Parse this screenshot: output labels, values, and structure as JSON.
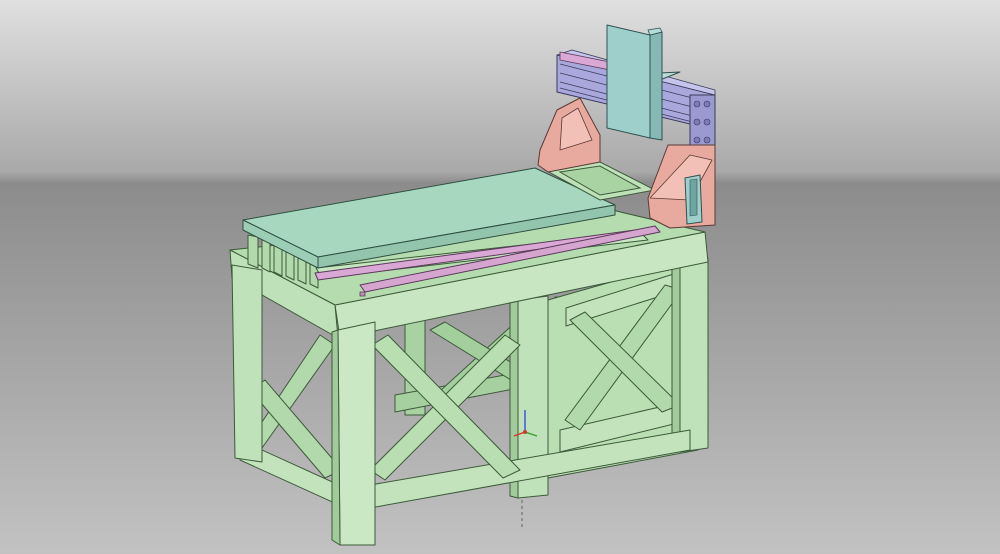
{
  "viewport": {
    "background_top": "#8e8e8e",
    "background_bottom": "#cfcfcf",
    "horizon_color": "#6f6f6f"
  },
  "model": {
    "parts": [
      {
        "name": "frame",
        "color": "#b5ddb0",
        "edge": "#3d5a3a"
      },
      {
        "name": "bed-plate",
        "color": "#a7d8bf",
        "edge": "#3d5a4a"
      },
      {
        "name": "linear-rail",
        "color": "#d9a8d4",
        "edge": "#5a3a5a"
      },
      {
        "name": "gantry-side",
        "color": "#e8aa9f",
        "edge": "#5a3a34"
      },
      {
        "name": "gantry-beam",
        "color": "#a9a8dc",
        "edge": "#3a3a5a"
      },
      {
        "name": "spindle-plate",
        "color": "#9fcfcb",
        "edge": "#2f5050"
      },
      {
        "name": "spindle-carriage",
        "color": "#b9dcd6",
        "edge": "#2f5050"
      }
    ]
  },
  "triad": {
    "x_color": "#e03020",
    "y_color": "#30a030",
    "z_color": "#3050e0"
  }
}
